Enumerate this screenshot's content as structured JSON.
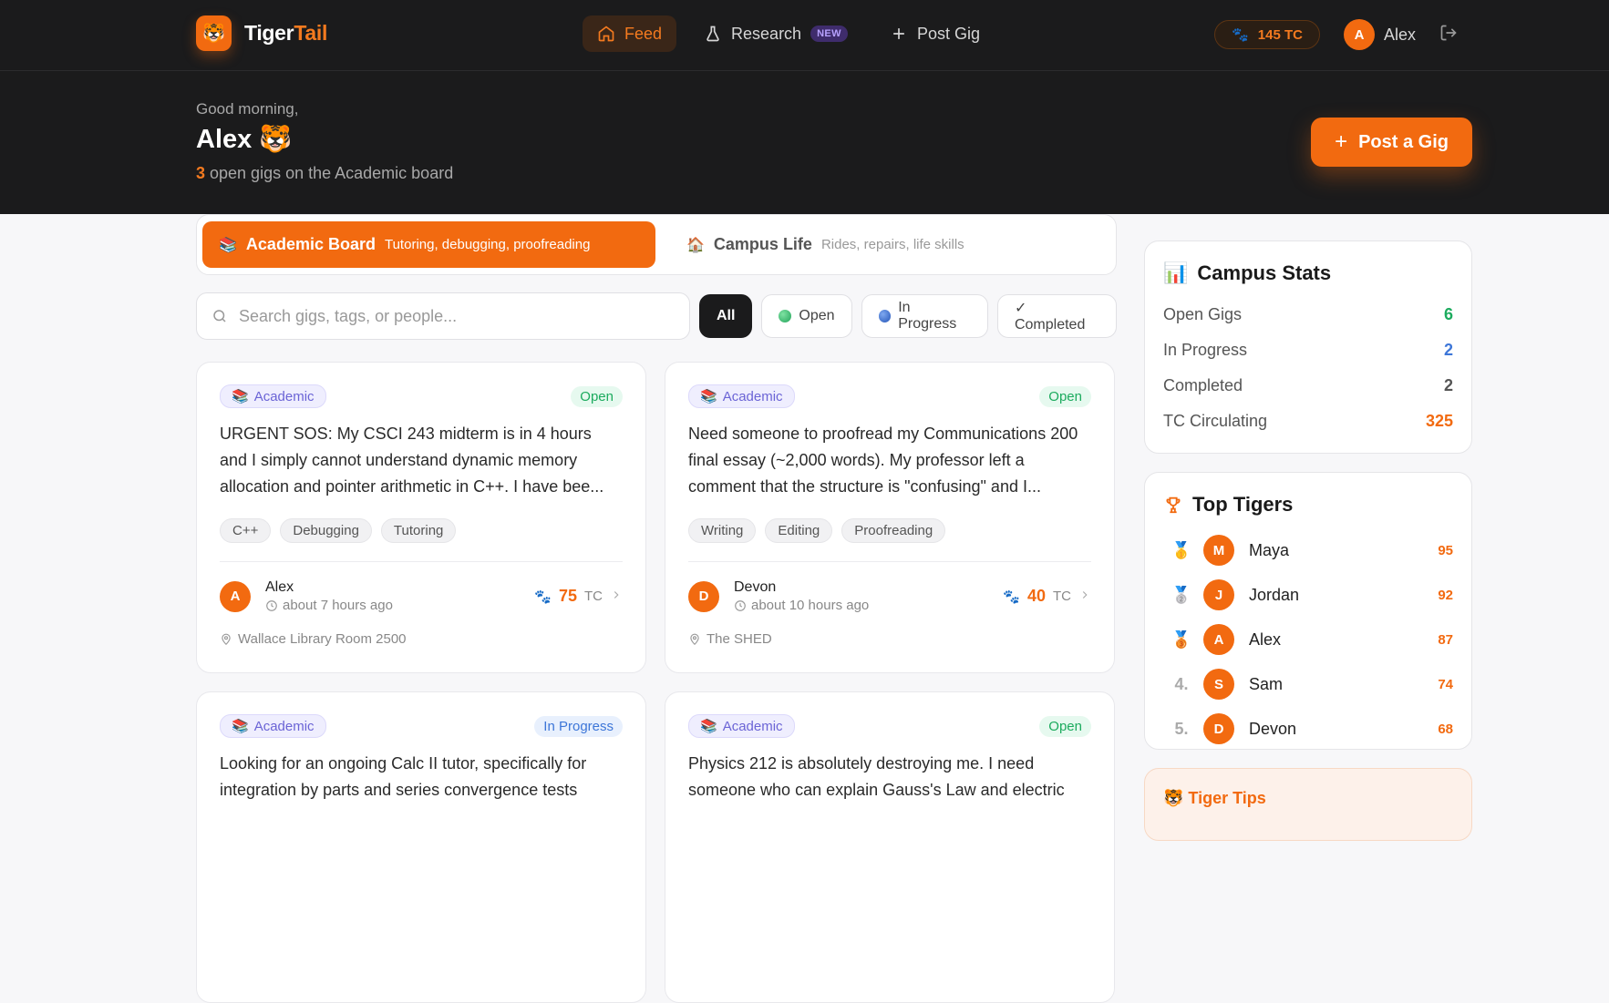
{
  "brand": {
    "name_main": "Tiger",
    "name_accent": "Tail",
    "logo": "🐯"
  },
  "nav": {
    "feed": "Feed",
    "research": "Research",
    "research_badge": "NEW",
    "post_gig": "Post Gig"
  },
  "account": {
    "tc_balance": "145 TC",
    "user_initial": "A",
    "user_name": "Alex"
  },
  "hero": {
    "greeting": "Good morning,",
    "name": "Alex 🐯",
    "open_count": "3",
    "open_text": " open gigs on the Academic board",
    "post_button": "Post a Gig"
  },
  "boards": [
    {
      "icon": "📚",
      "title": "Academic Board",
      "subtitle": "Tutoring, debugging, proofreading"
    },
    {
      "icon": "🏠",
      "title": "Campus Life",
      "subtitle": "Rides, repairs, life skills"
    }
  ],
  "search": {
    "placeholder": "Search gigs, tags, or people..."
  },
  "filters": {
    "all": "All",
    "open": "Open",
    "in_progress": "In Progress",
    "completed": "✓ Completed"
  },
  "gigs": [
    {
      "category": "Academic",
      "status": "Open",
      "text": "URGENT SOS: My CSCI 243 midterm is in 4 hours and I simply cannot understand dynamic memory allocation and pointer arithmetic in C++. I have bee...",
      "tags": [
        "C++",
        "Debugging",
        "Tutoring"
      ],
      "poster_initial": "A",
      "poster": "Alex",
      "time": "about 7 hours ago",
      "reward": "75",
      "unit": "TC",
      "location": "Wallace Library Room 2500"
    },
    {
      "category": "Academic",
      "status": "Open",
      "text": "Need someone to proofread my Communications 200 final essay (~2,000 words). My professor left a comment that the structure is \"confusing\" and I...",
      "tags": [
        "Writing",
        "Editing",
        "Proofreading"
      ],
      "poster_initial": "D",
      "poster": "Devon",
      "time": "about 10 hours ago",
      "reward": "40",
      "unit": "TC",
      "location": "The SHED"
    },
    {
      "category": "Academic",
      "status": "In Progress",
      "text": "Looking for an ongoing Calc II tutor, specifically for integration by parts and series convergence tests"
    },
    {
      "category": "Academic",
      "status": "Open",
      "text": "Physics 212 is absolutely destroying me. I need someone who can explain Gauss's Law and electric"
    }
  ],
  "stats": {
    "title": "Campus Stats",
    "rows": [
      {
        "label": "Open Gigs",
        "value": "6"
      },
      {
        "label": "In Progress",
        "value": "2"
      },
      {
        "label": "Completed",
        "value": "2"
      },
      {
        "label": "TC Circulating",
        "value": "325"
      }
    ]
  },
  "top_tigers": {
    "title": "Top Tigers",
    "rows": [
      {
        "rank": "🥇",
        "initial": "M",
        "name": "Maya",
        "score": "95"
      },
      {
        "rank": "🥈",
        "initial": "J",
        "name": "Jordan",
        "score": "92"
      },
      {
        "rank": "🥉",
        "initial": "A",
        "name": "Alex",
        "score": "87"
      },
      {
        "rank": "4.",
        "initial": "S",
        "name": "Sam",
        "score": "74"
      },
      {
        "rank": "5.",
        "initial": "D",
        "name": "Devon",
        "score": "68"
      }
    ]
  },
  "tips": {
    "title": "🐯 Tiger Tips"
  },
  "colors": {
    "accent": "#f26a10",
    "dark": "#1b1b1c",
    "open_green": "#1cab5e",
    "progress_blue": "#3d76d8"
  }
}
